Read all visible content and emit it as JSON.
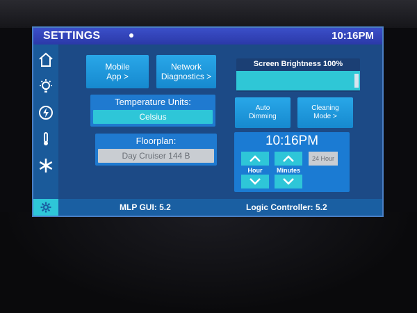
{
  "title_bar": {
    "title": "SETTINGS",
    "time": "10:16PM"
  },
  "sidebar": {
    "items": [
      {
        "name": "home",
        "icon": "home-icon"
      },
      {
        "name": "lighting",
        "icon": "lightbulb-icon"
      },
      {
        "name": "power",
        "icon": "power-icon"
      },
      {
        "name": "thermostat",
        "icon": "thermometer-icon"
      },
      {
        "name": "climate",
        "icon": "snowflake-icon"
      },
      {
        "name": "settings",
        "icon": "gear-icon"
      }
    ]
  },
  "buttons": {
    "mobile_app_line1": "Mobile",
    "mobile_app_line2": "App >",
    "network_line1": "Network",
    "network_line2": "Diagnostics >",
    "auto_dimming_line1": "Auto",
    "auto_dimming_line2": "Dimming",
    "cleaning_line1": "Cleaning",
    "cleaning_line2": "Mode >"
  },
  "temperature_units": {
    "label": "Temperature Units:",
    "value": "Celsius"
  },
  "floorplan": {
    "label": "Floorplan:",
    "value": "Day Cruiser 144 B"
  },
  "brightness": {
    "label": "Screen Brightness 100%",
    "level": 1.0
  },
  "clock": {
    "time": "10:16PM",
    "hour_label": "Hour",
    "minutes_label": "Minutes",
    "format_label": "24 Hour"
  },
  "status_bar": {
    "gui_version": "MLP GUI: 5.2",
    "logic_version": "Logic Controller: 5.2"
  },
  "colors": {
    "screen_bg": "#1c4a86",
    "title_bar": "#2b39a8",
    "button": "#1f8fd6",
    "accent_cyan": "#2ec6d8",
    "disabled_grey": "#c9cdd2"
  }
}
